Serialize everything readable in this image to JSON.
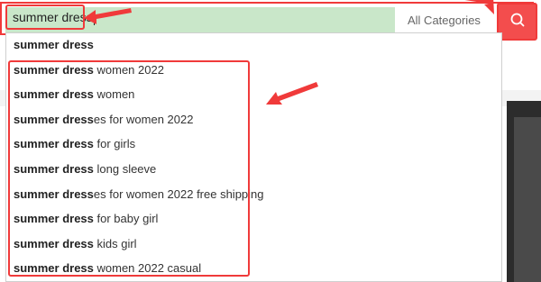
{
  "search": {
    "query": "summer dress",
    "category": "All Categories"
  },
  "suggestions": [
    {
      "bold": "summer dress",
      "rest": ""
    },
    {
      "bold": "summer dress",
      "rest": " women 2022"
    },
    {
      "bold": "summer dress",
      "rest": " women"
    },
    {
      "bold": "summer dress",
      "rest": "es for women 2022"
    },
    {
      "bold": "summer dress",
      "rest": " for girls"
    },
    {
      "bold": "summer dress",
      "rest": " long sleeve"
    },
    {
      "bold": "summer dress",
      "rest": "es for women 2022 free shipping"
    },
    {
      "bold": "summer dress",
      "rest": " for baby girl"
    },
    {
      "bold": "summer dress",
      "rest": " kids girl"
    },
    {
      "bold": "summer dress",
      "rest": " women 2022 casual"
    }
  ],
  "colors": {
    "accent": "#f03a3a",
    "search_button": "#f34d4d",
    "input_bg": "#c9e7c9"
  },
  "icons": {
    "search_button": "search-icon"
  }
}
